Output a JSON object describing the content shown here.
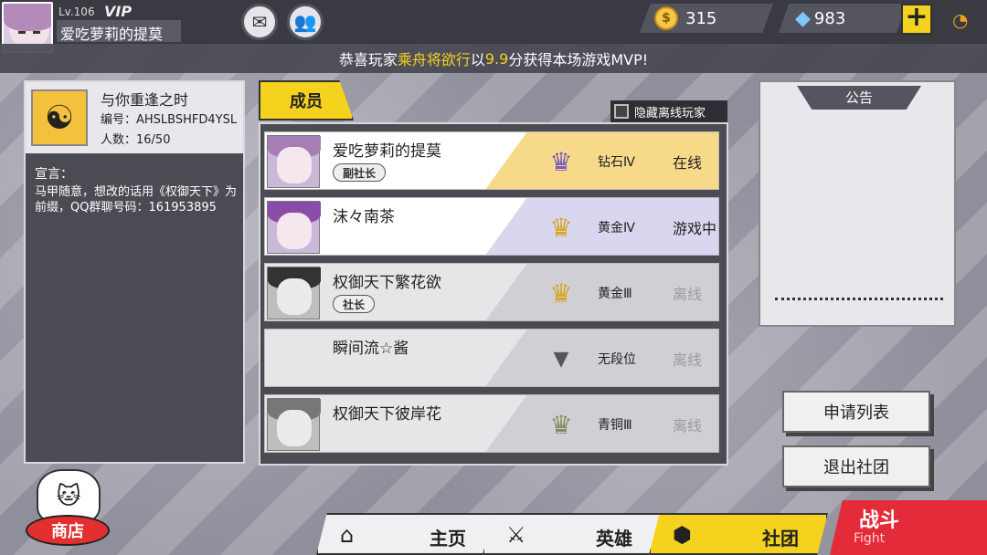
{
  "player": {
    "level": "Lv.106",
    "vip": "VIP",
    "name": "爱吃萝莉的提莫"
  },
  "top_icons": {
    "mail": "mail-icon",
    "friends": "friends-icon",
    "plus": "plus-icon",
    "wifi": "wifi-icon"
  },
  "currency": {
    "coins": "315",
    "diamonds": "983"
  },
  "announce": {
    "prefix": "恭喜玩家",
    "player": "乘舟将欲行",
    "mid": "以",
    "score": "9.9",
    "suffix": "分获得本场游戏MVP!"
  },
  "guild": {
    "name": "与你重逢之时",
    "id": "编号：AHSLBSHFD4YSL",
    "count": "人数：16/50",
    "declaration_title": "宣言：",
    "declaration": "马甲随意，想改的话用《权御天下》为前缀，QQ群聊号码：161953895"
  },
  "members_tab": {
    "label": "成员",
    "hide_offline": "隐藏离线玩家"
  },
  "members": [
    {
      "name": "爱吃萝莉的提莫",
      "role": "副社长",
      "rank": "钻石Ⅳ",
      "status": "在线"
    },
    {
      "name": "沫々南茶",
      "role": "",
      "rank": "黄金Ⅳ",
      "status": "游戏中"
    },
    {
      "name": "权御天下繁花欲",
      "role": "社长",
      "rank": "黄金Ⅲ",
      "status": "离线"
    },
    {
      "name": "瞬间流☆酱",
      "role": "",
      "rank": "无段位",
      "status": "离线"
    },
    {
      "name": "权御天下彼岸花",
      "role": "",
      "rank": "青铜Ⅲ",
      "status": "离线"
    }
  ],
  "notice": {
    "title": "公告"
  },
  "buttons": {
    "apply_list": "申请列表",
    "quit_guild": "退出社团"
  },
  "nav": {
    "shop": "商店",
    "home": "主页",
    "heroes": "英雄",
    "guild": "社团",
    "fight_cn": "战斗",
    "fight_en": "Fight"
  },
  "colors": {
    "accent_yellow": "#f5d21e",
    "fight_red": "#e32b3a"
  }
}
